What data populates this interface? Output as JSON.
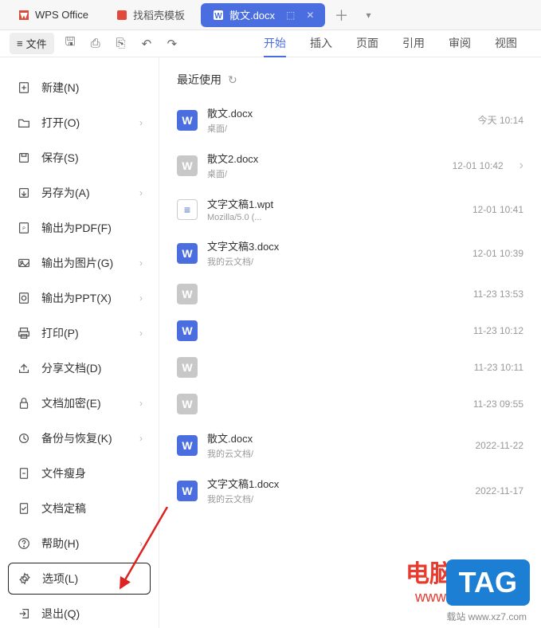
{
  "tabs": {
    "home": "WPS Office",
    "tpl": "找稻壳模板",
    "doc": "散文.docx"
  },
  "filebtn": "文件",
  "ribbon": {
    "start": "开始",
    "insert": "插入",
    "page": "页面",
    "ref": "引用",
    "review": "审阅",
    "view": "视图"
  },
  "menu": {
    "new": "新建(N)",
    "open": "打开(O)",
    "save": "保存(S)",
    "saveas": "另存为(A)",
    "pdf": "输出为PDF(F)",
    "img": "输出为图片(G)",
    "ppt": "输出为PPT(X)",
    "print": "打印(P)",
    "share": "分享文档(D)",
    "encrypt": "文档加密(E)",
    "backup": "备份与恢复(K)",
    "slim": "文件瘦身",
    "final": "文档定稿",
    "help": "帮助(H)",
    "options": "选项(L)",
    "exit": "退出(Q)"
  },
  "recent": {
    "header": "最近使用",
    "items": [
      {
        "name": "散文.docx",
        "path": "桌面/",
        "time": "今天 10:14",
        "ic": "blue"
      },
      {
        "name": "散文2.docx",
        "path": "桌面/",
        "time": "12-01 10:42",
        "ic": "gray",
        "chev": true
      },
      {
        "name": "文字文稿1.wpt",
        "path": "Mozilla/5.0 (...",
        "time": "12-01 10:41",
        "ic": "wpt"
      },
      {
        "name": "文字文稿3.docx",
        "path": "我的云文档/",
        "time": "12-01 10:39",
        "ic": "blue"
      },
      {
        "name": "",
        "path": "",
        "time": "11-23 13:53",
        "ic": "gray",
        "blur": true
      },
      {
        "name": "",
        "path": "",
        "time": "11-23 10:12",
        "ic": "blue",
        "blur": true
      },
      {
        "name": "",
        "path": "",
        "time": "11-23 10:11",
        "ic": "gray",
        "blur": true
      },
      {
        "name": "",
        "path": "",
        "time": "11-23 09:55",
        "ic": "gray",
        "blur": true
      },
      {
        "name": "散文.docx",
        "path": "我的云文档/",
        "time": "2022-11-22",
        "ic": "blue"
      },
      {
        "name": "文字文稿1.docx",
        "path": "我的云文档/",
        "time": "2022-11-17",
        "ic": "blue"
      }
    ]
  },
  "wm": {
    "t1": "电脑技术网",
    "t2": "www.tagxp.com",
    "tag": "TAG",
    "sub": "载站\nwww.xz7.com"
  }
}
